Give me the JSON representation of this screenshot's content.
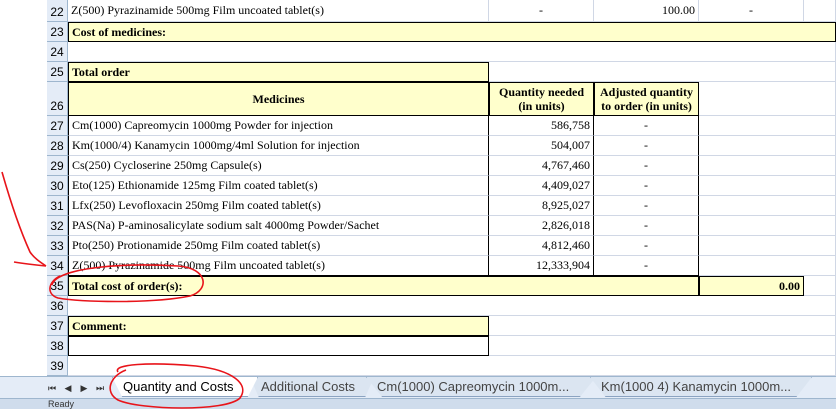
{
  "rows": {
    "r22": {
      "num": "22",
      "name": "Z(500)  Pyrazinamide  500mg  Film uncoated tablet(s)",
      "c1": "-",
      "c2": "100.00",
      "c3": "-"
    },
    "r23": {
      "num": "23",
      "label": "Cost of medicines:"
    },
    "r24": {
      "num": "24"
    },
    "r25": {
      "num": "25",
      "label": "Total order"
    },
    "r26": {
      "num": "26",
      "medicines": "Medicines",
      "qty_needed": "Quantity needed (in units)",
      "adjusted": "Adjusted quantity to order (in units)"
    }
  },
  "medicines": [
    {
      "num": "27",
      "name": "Cm(1000)  Capreomycin  1000mg  Powder for injection",
      "qty": "586,758",
      "adj": "-"
    },
    {
      "num": "28",
      "name": "Km(1000/4)  Kanamycin  1000mg/4ml  Solution for injection",
      "qty": "504,007",
      "adj": "-"
    },
    {
      "num": "29",
      "name": "Cs(250)  Cycloserine  250mg  Capsule(s)",
      "qty": "4,767,460",
      "adj": "-"
    },
    {
      "num": "30",
      "name": "Eto(125)  Ethionamide  125mg  Film coated tablet(s)",
      "qty": "4,409,027",
      "adj": "-"
    },
    {
      "num": "31",
      "name": "Lfx(250)  Levofloxacin  250mg  Film coated tablet(s)",
      "qty": "8,925,027",
      "adj": "-"
    },
    {
      "num": "32",
      "name": "PAS(Na)  P-aminosalicylate sodium salt  4000mg  Powder/Sachet",
      "qty": "2,826,018",
      "adj": "-"
    },
    {
      "num": "33",
      "name": "Pto(250)  Protionamide   250mg  Film coated tablet(s)",
      "qty": "4,812,460",
      "adj": "-"
    },
    {
      "num": "34",
      "name": "Z(500)  Pyrazinamide  500mg  Film uncoated tablet(s)",
      "qty": "12,333,904",
      "adj": "-"
    }
  ],
  "r35": {
    "num": "35",
    "label": "Total cost of order(s):",
    "value": "0.00"
  },
  "r36": {
    "num": "36"
  },
  "r37": {
    "num": "37",
    "label": "Comment:"
  },
  "r38": {
    "num": "38"
  },
  "r39": {
    "num": "39"
  },
  "tabs": [
    {
      "label": "Quantity and Costs",
      "active": true
    },
    {
      "label": "Additional Costs"
    },
    {
      "label": "Cm(1000)  Capreomycin  1000m..."
    },
    {
      "label": "Km(1000 4)  Kanamycin  1000m..."
    }
  ],
  "status": "Ready",
  "colors": {
    "cell_yellow": "#ffffcc",
    "annotation_red": "#e8141a",
    "row_header_bg": "#e4ecf7"
  }
}
